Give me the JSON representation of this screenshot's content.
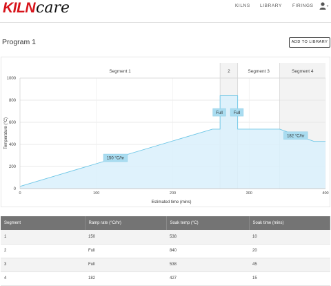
{
  "header": {
    "logo_kiln": "KILN",
    "logo_care": "care",
    "nav": [
      "KILNS",
      "LIBRARY",
      "FIRINGS"
    ],
    "user_icon": "user-icon"
  },
  "page": {
    "title": "Program 1",
    "add_button": "ADD TO LIBRARY"
  },
  "chart_data": {
    "type": "area",
    "xlabel": "Estimated time (mins)",
    "ylabel": "Temperature (°C)",
    "xlim": [
      0,
      400
    ],
    "ylim": [
      0,
      1000
    ],
    "x_ticks": [
      0,
      100,
      200,
      300,
      400
    ],
    "y_ticks": [
      0,
      200,
      400,
      600,
      800,
      1000
    ],
    "grid": true,
    "fill_color": "#d9f0fb",
    "line_color": "#6cc6e6",
    "segment_band_colors": [
      "#ffffff",
      "#eaeaea"
    ],
    "segments": [
      {
        "label": "Segment 1",
        "x": [
          0,
          262
        ]
      },
      {
        "label": "2",
        "x": [
          262,
          285
        ]
      },
      {
        "label": "Segment 3",
        "x": [
          285,
          340
        ]
      },
      {
        "label": "Segment 4",
        "x": [
          340,
          400
        ]
      }
    ],
    "series": [
      {
        "x": [
          0,
          252,
          262,
          262,
          262,
          285,
          285,
          340,
          340,
          385,
          400
        ],
        "y": [
          20,
          538,
          538,
          840,
          840,
          840,
          538,
          538,
          538,
          427,
          427
        ]
      }
    ],
    "annotations": [
      {
        "text": "150 °C/hr",
        "x": 125,
        "y": 278
      },
      {
        "text": "Full",
        "x": 261,
        "y": 690
      },
      {
        "text": "Full",
        "x": 284,
        "y": 690
      },
      {
        "text": "182 °C/hr",
        "x": 361,
        "y": 480
      }
    ]
  },
  "table": {
    "headers": [
      "Segment",
      "Ramp rate (°C/hr)",
      "Soak temp (°C)",
      "Soak time (mins)"
    ],
    "rows": [
      [
        "1",
        "150",
        "538",
        "10"
      ],
      [
        "2",
        "Full",
        "840",
        "20"
      ],
      [
        "3",
        "Full",
        "538",
        "45"
      ],
      [
        "4",
        "182",
        "427",
        "15"
      ]
    ]
  },
  "colors": {
    "brand_red": "#d7141b",
    "table_header": "#747474"
  }
}
